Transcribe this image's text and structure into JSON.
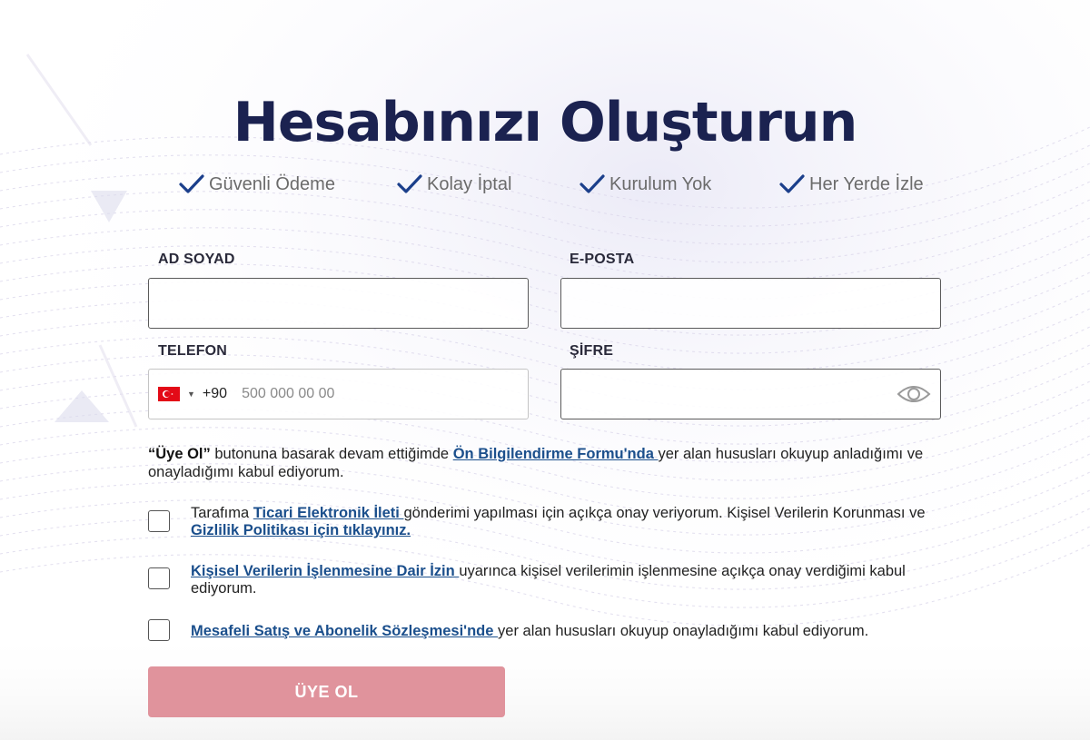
{
  "page": {
    "title": "Hesabınızı Oluşturun"
  },
  "features": [
    {
      "label": "Güvenli Ödeme",
      "icon": "check-icon"
    },
    {
      "label": "Kolay İptal",
      "icon": "check-icon"
    },
    {
      "label": "Kurulum Yok",
      "icon": "check-icon"
    },
    {
      "label": "Her Yerde İzle",
      "icon": "check-icon"
    }
  ],
  "form": {
    "name_label": "AD SOYAD",
    "name_value": "",
    "email_label": "E-POSTA",
    "email_value": "",
    "phone_label": "TELEFON",
    "phone_dial_code": "+90",
    "phone_placeholder": "500 000 00 00",
    "phone_country_icon": "turkey-flag-icon",
    "password_label": "ŞİFRE",
    "password_value": "",
    "password_toggle_icon": "eye-icon"
  },
  "consent": {
    "main_bold": "“Üye Ol”",
    "main_text_1": " butonuna basarak devam ettiğimde ",
    "main_link": "Ön Bilgilendirme Formu'nda ",
    "main_text_2": "yer alan hususları okuyup anladığımı ve onayladığımı kabul ediyorum.",
    "cb1_text_1": "Tarafıma ",
    "cb1_link_1": "Ticari Elektronik İleti ",
    "cb1_text_2": " gönderimi yapılması için açıkça onay veriyorum. Kişisel Verilerin Korunması ve ",
    "cb1_link_2": "Gizlilik Politikası için tıklayınız.",
    "cb2_link": "Kişisel Verilerin İşlenmesine Dair İzin ",
    "cb2_text": " uyarınca kişisel verilerimin işlenmesine açıkça onay verdiğimi kabul ediyorum.",
    "cb3_link": "Mesafeli Satış ve Abonelik Sözleşmesi'nde ",
    "cb3_text": " yer alan hususları okuyup onayladığımı kabul ediyorum."
  },
  "submit": {
    "label": "ÜYE OL"
  },
  "colors": {
    "title": "#1b2250",
    "check": "#1b3f8b",
    "link": "#1b4f8c",
    "submit_bg": "#e0939c"
  }
}
